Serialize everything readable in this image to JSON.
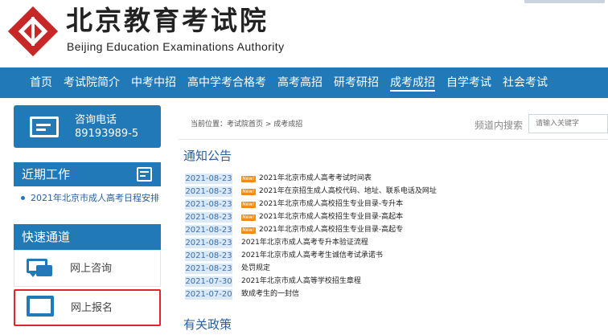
{
  "header": {
    "title_cn": "北京教育考试院",
    "title_en": "Beijing Education Examinations Authority",
    "brand_color": "#c62828"
  },
  "nav": {
    "items": [
      "首页",
      "考试院简介",
      "中考中招",
      "高中学考合格考",
      "高考高招",
      "研考研招",
      "成考成招",
      "自学考试",
      "社会考试"
    ],
    "active_index": 6,
    "color": "#2279b8"
  },
  "sidebar": {
    "hotline": {
      "label": "咨询电话",
      "number": "89193989-5",
      "icon": "phone-card-icon"
    },
    "recent": {
      "title": "近期工作",
      "icon": "calendar-icon",
      "items": [
        "2021年北京市成人高考日程安排"
      ]
    },
    "quick": {
      "title": "快速通道",
      "items": [
        {
          "label": "网上咨询",
          "icon": "chat-icon"
        },
        {
          "label": "网上报名",
          "icon": "monitor-icon"
        }
      ]
    }
  },
  "main": {
    "breadcrumb": "当前位置：考试院首页 > 成考成招",
    "search": {
      "label": "频道内搜索",
      "placeholder": "请输入关键字"
    },
    "notice_title": "通知公告",
    "policy_title": "有关政策",
    "new_badge": "New!",
    "notices": [
      {
        "date": "2021-08-23",
        "new": true,
        "title": "2021年北京市成人高考考试时间表"
      },
      {
        "date": "2021-08-23",
        "new": true,
        "title": "2021年在京招生成人高校代码、地址、联系电话及网址"
      },
      {
        "date": "2021-08-23",
        "new": true,
        "title": "2021年北京市成人高校招生专业目录-专升本"
      },
      {
        "date": "2021-08-23",
        "new": true,
        "title": "2021年北京市成人高校招生专业目录-高起本"
      },
      {
        "date": "2021-08-23",
        "new": true,
        "title": "2021年北京市成人高校招生专业目录-高起专"
      },
      {
        "date": "2021-08-23",
        "new": false,
        "title": "2021年北京市成人高考专升本验证流程"
      },
      {
        "date": "2021-08-23",
        "new": false,
        "title": "2021年北京市成人高考考生诚信考试承诺书"
      },
      {
        "date": "2021-08-23",
        "new": false,
        "title": "处罚规定"
      },
      {
        "date": "2021-07-30",
        "new": false,
        "title": "2021年北京市成人高等学校招生章程"
      },
      {
        "date": "2021-07-20",
        "new": false,
        "title": "致成考生的一封信"
      }
    ]
  }
}
